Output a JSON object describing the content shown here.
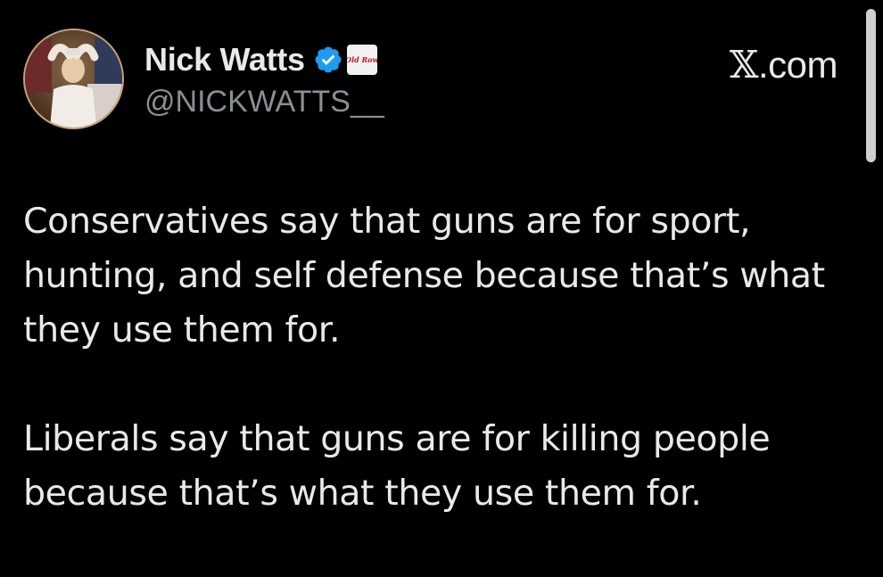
{
  "author": {
    "display_name": "Nick Watts",
    "handle": "@NICKWATTS__",
    "avatar_icon": "user-avatar-photo",
    "verified_icon": "verified-badge-icon",
    "verified_color": "#1d9bf0",
    "affiliate_label": "Old Row",
    "affiliate_icon": "affiliate-logo-icon"
  },
  "site": {
    "mark_glyph": "𝕏",
    "mark_text": ".com"
  },
  "tweet": {
    "paragraphs": [
      "Conservatives say that guns are for sport,\nhunting, and self defense because that’s what\nthey use them for.",
      "Liberals say that guns are for killing people\nbecause that’s what they use them for."
    ]
  },
  "colors": {
    "background": "#000000",
    "text": "#e7e9ea",
    "secondary_text": "#8a8f94"
  }
}
